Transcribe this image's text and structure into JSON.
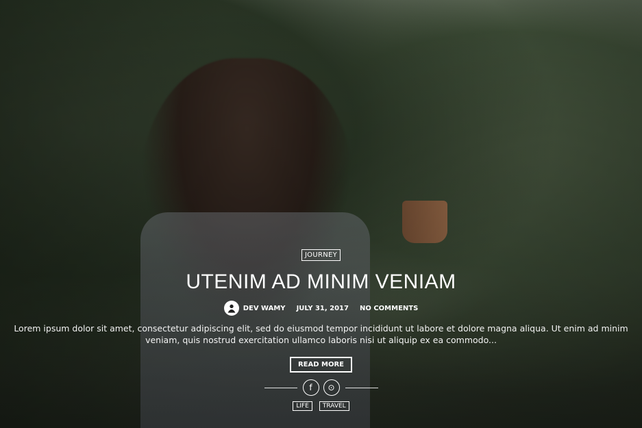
{
  "post": {
    "category": "JOURNEY",
    "title": "UTENIM AD MINIM VENIAM",
    "author": "DEV WAMY",
    "date": "JULY 31, 2017",
    "comments": "NO COMMENTS",
    "excerpt": "Lorem ipsum dolor sit amet, consectetur adipiscing elit, sed do eiusmod tempor incididunt ut labore et dolore magna aliqua. Ut enim ad minim veniam, quis nostrud exercitation ullamco laboris nisi ut aliquip ex ea commodo...",
    "read_more": "READ MORE",
    "share": {
      "facebook_icon": "facebook-icon",
      "pinterest_icon": "pinterest-icon"
    },
    "tags": [
      "LIFE",
      "TRAVEL"
    ]
  },
  "colors": {
    "text": "#ffffff"
  }
}
